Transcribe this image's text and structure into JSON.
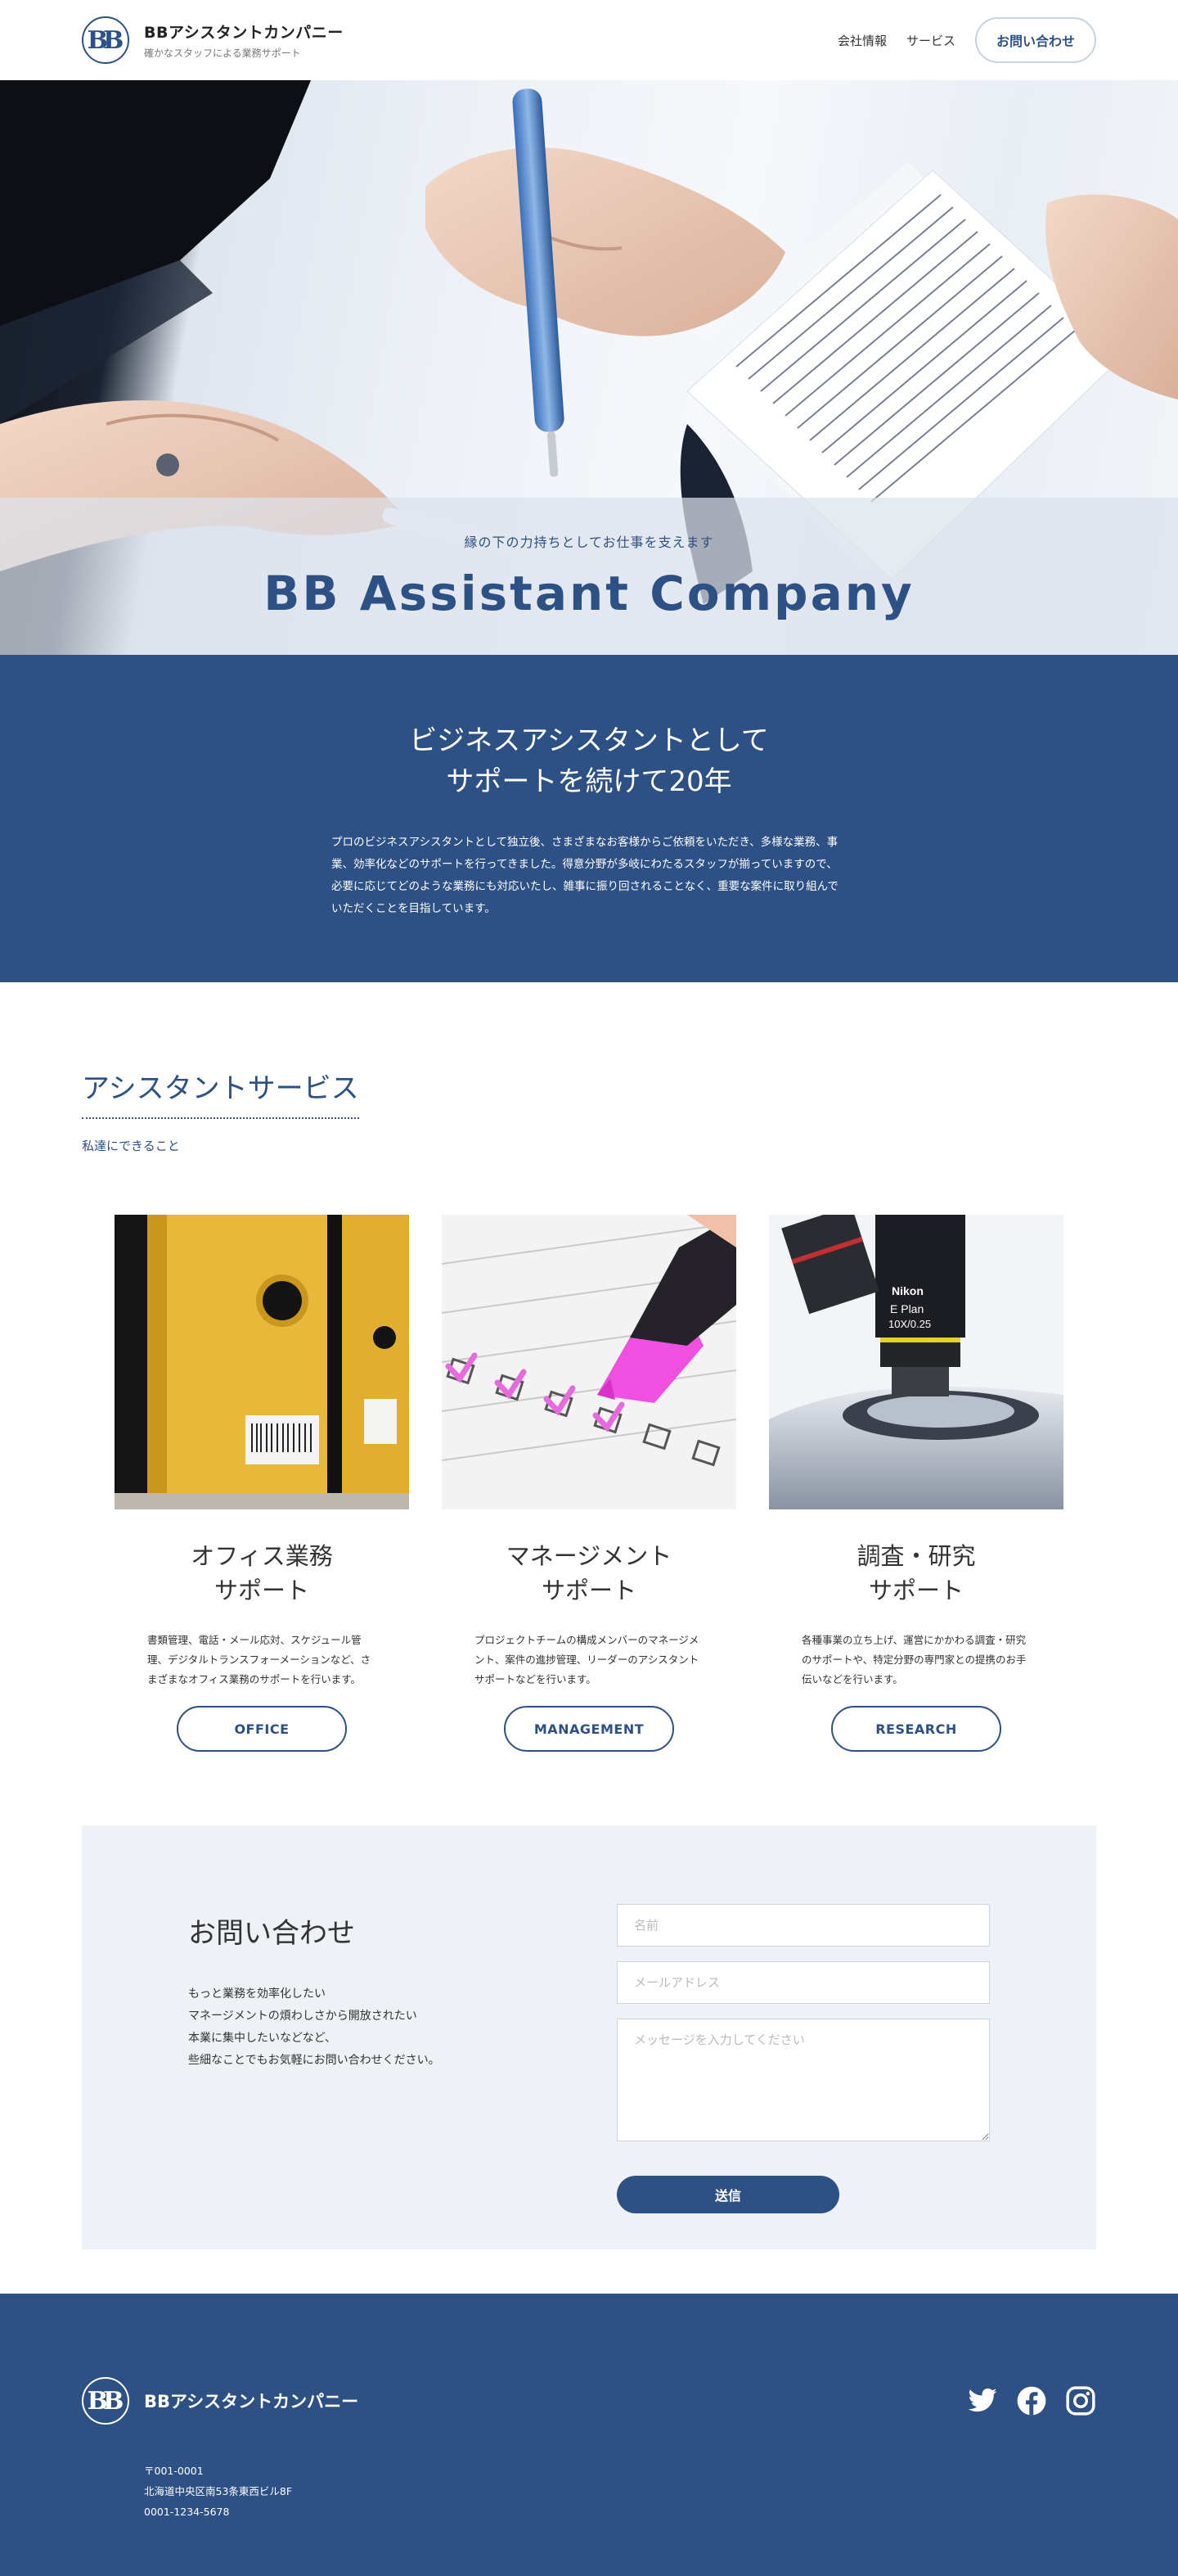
{
  "header": {
    "brand_name": "BBアシスタントカンパニー",
    "brand_tagline": "確かなスタッフによる業務サポート",
    "logo_text": "BB",
    "nav": [
      "会社情報",
      "サービス"
    ],
    "cta_label": "お問い合わせ"
  },
  "hero": {
    "subtitle": "縁の下の力持ちとしてお仕事を支えます",
    "title": "BB Assistant Company"
  },
  "intro": {
    "title_line1": "ビジネスアシスタントとして",
    "title_line2": "サポートを続けて20年",
    "text": "プロのビジネスアシスタントとして独立後、さまざまなお客様からご依頼をいただき、多様な業務、事業、効率化などのサポートを行ってきました。得意分野が多岐にわたるスタッフが揃っていますので、必要に応じてどのような業務にも対応いたし、雑事に振り回されることなく、重要な案件に取り組んでいただくことを目指しています。"
  },
  "services": {
    "title": "アシスタントサービス",
    "subtitle": "私達にできること",
    "cards": [
      {
        "title_line1": "オフィス業務",
        "title_line2": "サポート",
        "text": "書類管理、電話・メール応対、スケジュール管理、デジタルトランスフォーメーションなど、さまざまなオフィス業務のサポートを行います。",
        "button": "OFFICE",
        "image_icon": "yellow-binders-image"
      },
      {
        "title_line1": "マネージメント",
        "title_line2": "サポート",
        "text": "プロジェクトチームの構成メンバーのマネージメント、案件の進捗管理、リーダーのアシスタントサポートなどを行います。",
        "button": "MANAGEMENT",
        "image_icon": "checklist-marker-image"
      },
      {
        "title_line1": "調査・研究",
        "title_line2": "サポート",
        "text": "各種事業の立ち上げ、運営にかかわる調査・研究のサポートや、特定分野の専門家との提携のお手伝いなどを行います。",
        "button": "RESEARCH",
        "image_icon": "microscope-image",
        "lens_brand": "Nikon",
        "lens_model": "E Plan",
        "lens_spec": "10X/0.25"
      }
    ]
  },
  "contact": {
    "title": "お問い合わせ",
    "lines": [
      "もっと業務を効率化したい",
      "マネージメントの煩わしさから開放されたい",
      "本業に集中したいなどなど、",
      "些細なことでもお気軽にお問い合わせください。"
    ],
    "name_placeholder": "名前",
    "email_placeholder": "メールアドレス",
    "message_placeholder": "メッセージを入力してください",
    "submit_label": "送信"
  },
  "footer": {
    "name": "BBアシスタントカンパニー",
    "postal": "〒001-0001",
    "address": "北海道中央区南53条東西ビル8F",
    "phone": "0001-1234-5678",
    "socials": [
      "twitter-icon",
      "facebook-icon",
      "instagram-icon"
    ]
  },
  "colors": {
    "primary": "#2d5184",
    "contact_bg": "#eef2f6"
  }
}
